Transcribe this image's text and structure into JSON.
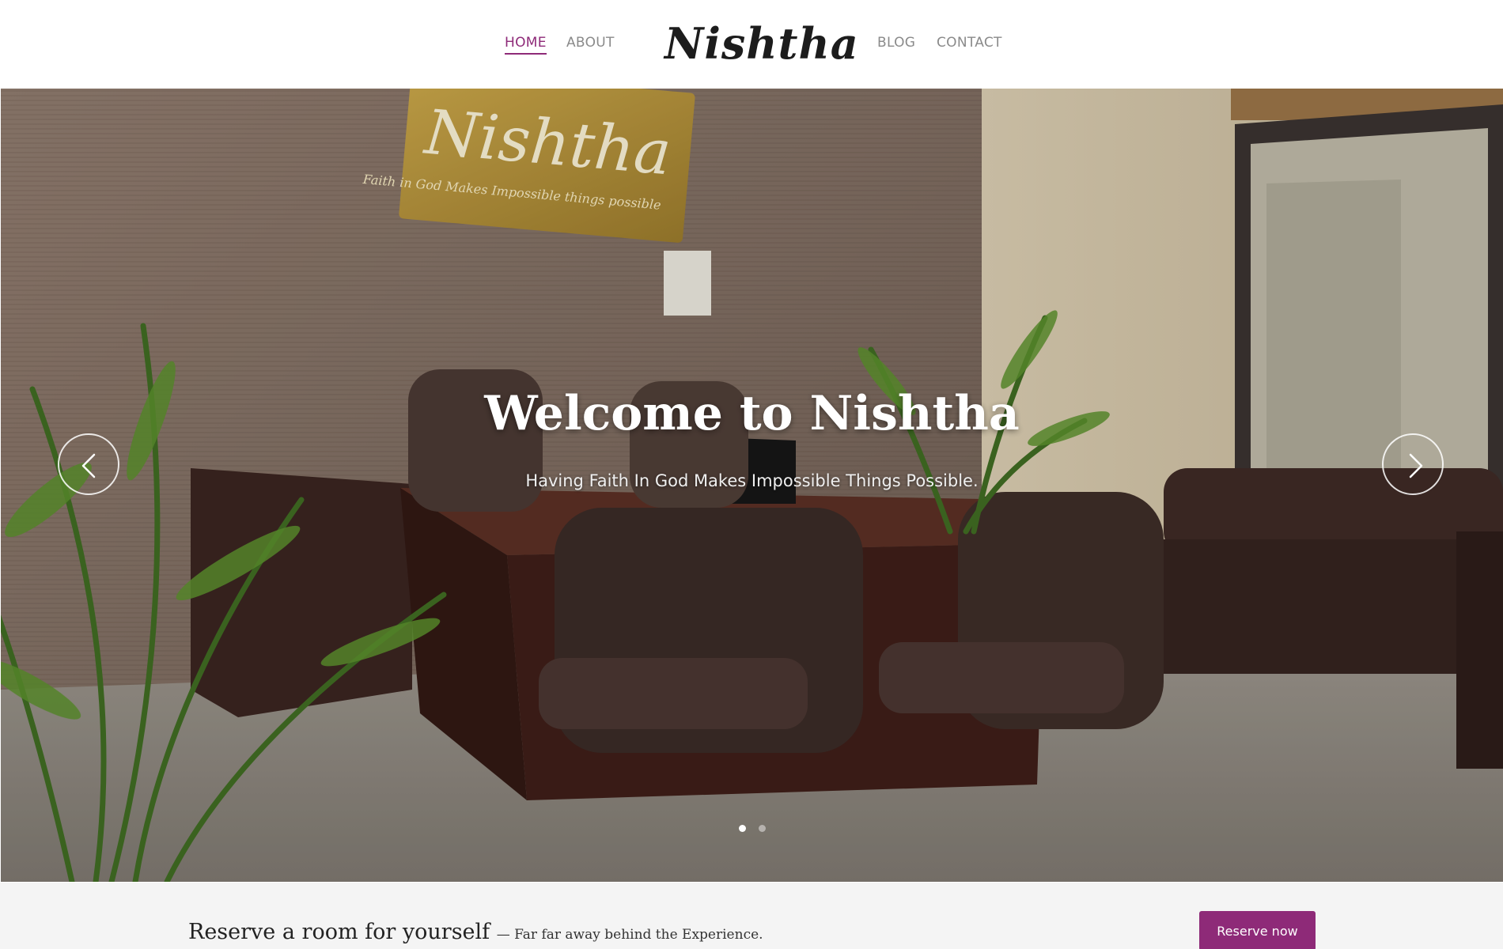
{
  "nav": {
    "home": "HOME",
    "about": "ABOUT",
    "brand": "Nishtha",
    "blog": "BLOG",
    "contact": "CONTACT"
  },
  "hero": {
    "title": "Welcome to Nishtha",
    "subtitle": "Having Faith In God Makes Impossible Things Possible.",
    "sign_text": "Nishtha",
    "sign_tagline": "Faith in God Makes Impossible things possible",
    "prev_icon": "chevron-left-icon",
    "next_icon": "chevron-right-icon",
    "slide_count": 2,
    "active_slide": 1
  },
  "reserve": {
    "title": "Reserve a room for yourself",
    "subtitle": "— Far far away behind the Experience.",
    "button": "Reserve now"
  },
  "colors": {
    "accent": "#8e2a78",
    "nav_text": "#8a8a8a",
    "strip_background": "#f4f4f4"
  }
}
